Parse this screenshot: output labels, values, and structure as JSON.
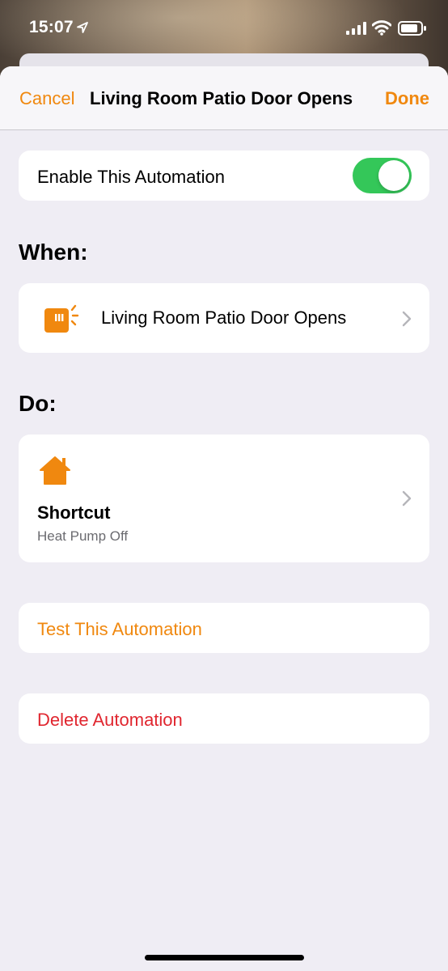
{
  "status_bar": {
    "time": "15:07"
  },
  "nav": {
    "cancel_label": "Cancel",
    "title": "Living Room Patio Door Opens",
    "done_label": "Done"
  },
  "enable": {
    "label": "Enable This Automation",
    "enabled": true
  },
  "when": {
    "heading": "When:",
    "trigger_label": "Living Room Patio Door Opens",
    "trigger_icon": "door-sensor-icon"
  },
  "do": {
    "heading": "Do:",
    "action_icon": "home-icon",
    "action_title": "Shortcut",
    "action_subtitle": "Heat Pump Off"
  },
  "actions": {
    "test_label": "Test This Automation",
    "delete_label": "Delete Automation"
  },
  "colors": {
    "accent": "#f0880f",
    "toggle_on": "#34c759",
    "destructive": "#e0262f",
    "background": "#efedf4"
  }
}
